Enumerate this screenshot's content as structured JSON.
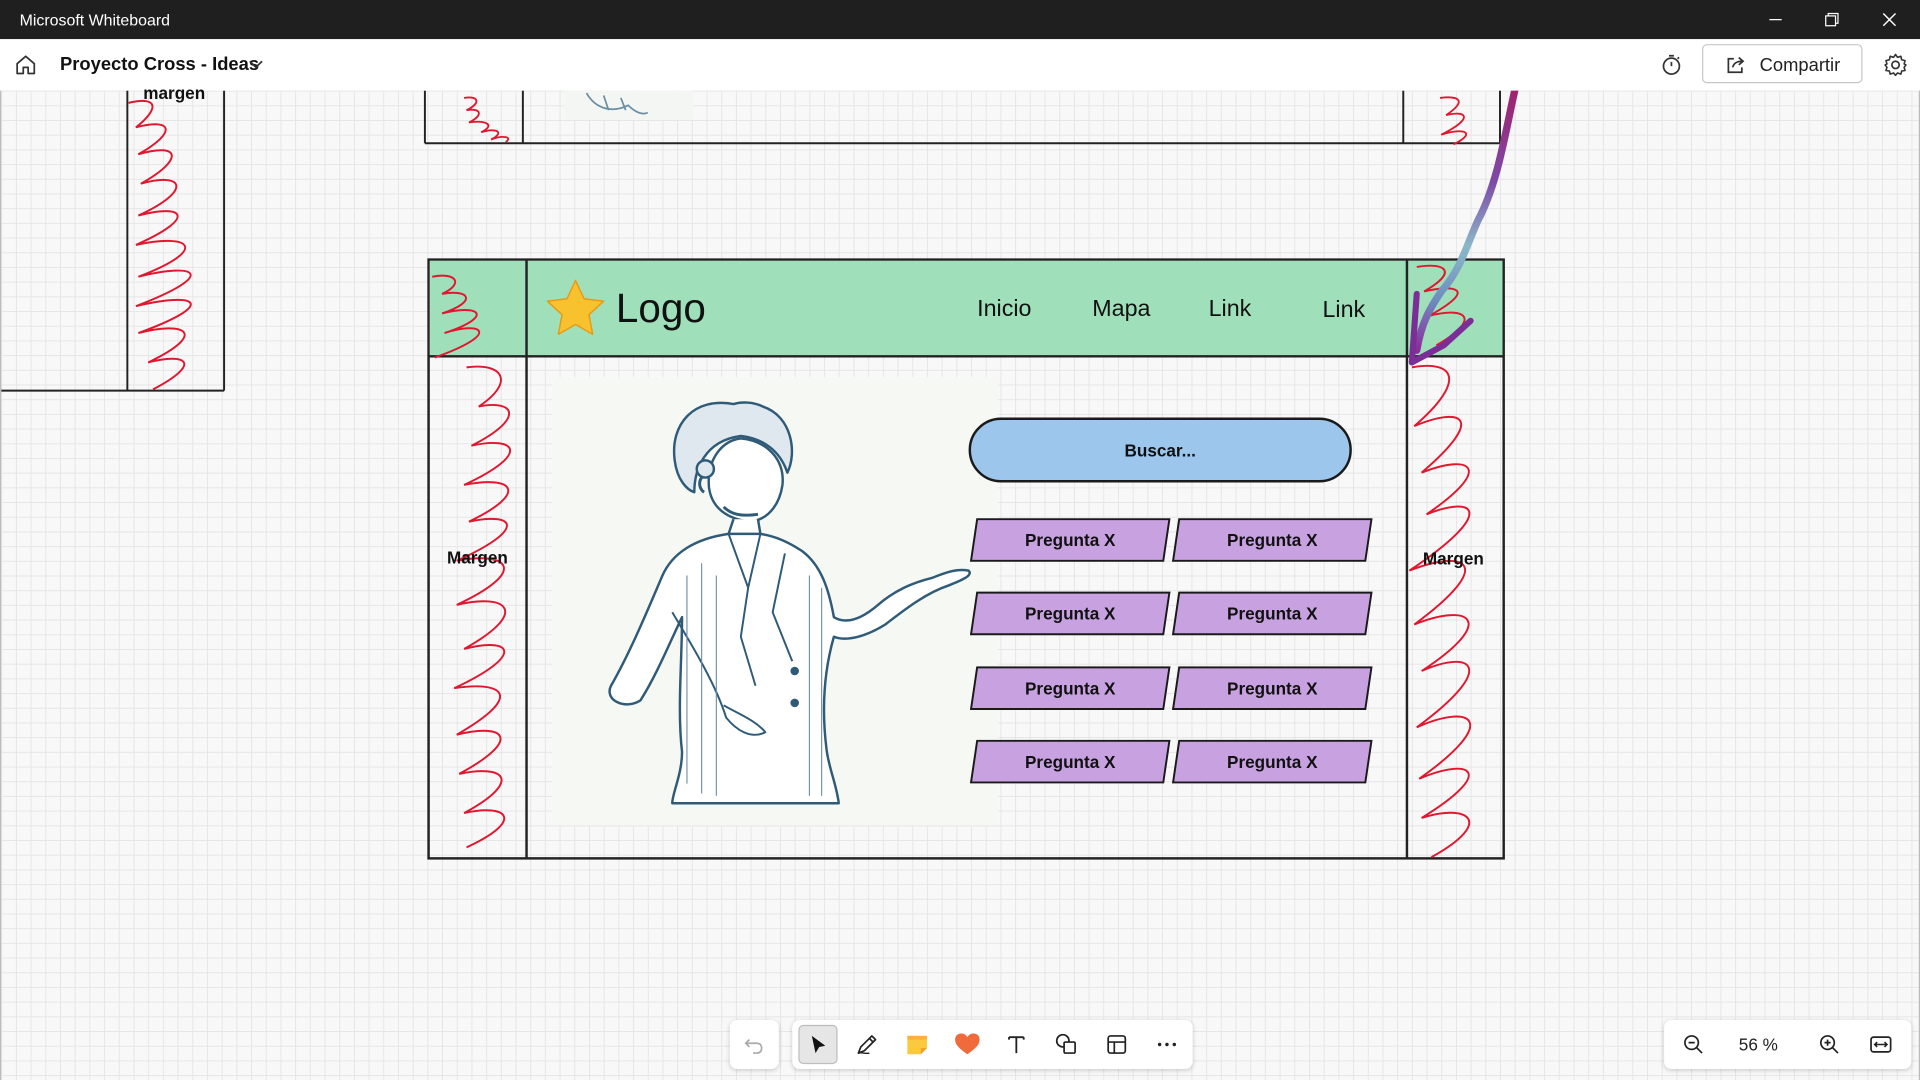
{
  "window": {
    "title": "Microsoft Whiteboard"
  },
  "header": {
    "board_name": "Proyecto Cross - Ideas",
    "share_label": "Compartir"
  },
  "wireframe": {
    "logo_label": "Logo",
    "nav_items": [
      "Inicio",
      "Mapa",
      "Link",
      "Link"
    ],
    "search_placeholder": "Buscar...",
    "margin_label": "Margen",
    "margin_label_partial": "margen",
    "question_label": "Pregunta X",
    "question_count": 8
  },
  "colors": {
    "header_green": "#9fe0bb",
    "search_blue": "#9dc6ec",
    "question_purple": "#c8a2e0",
    "scribble_red": "#e0172f",
    "ink_purple": "#8a3fa0"
  },
  "toolbar": {
    "tools": [
      "undo-icon",
      "select-icon",
      "pen-icon",
      "sticky-note-icon",
      "reaction-icon",
      "text-icon",
      "shapes-icon",
      "templates-icon",
      "more-icon"
    ],
    "active_tool": "select-icon"
  },
  "zoom": {
    "value": "56 %"
  }
}
